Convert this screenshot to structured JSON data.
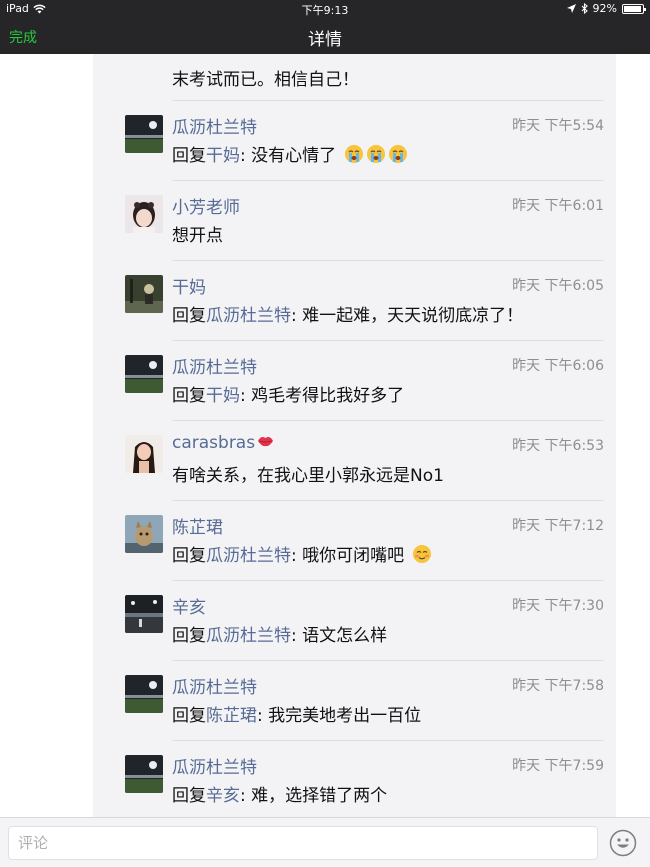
{
  "status_bar": {
    "device": "iPad",
    "time": "下午9:13",
    "battery": "92%",
    "battery_level": 0.92,
    "icons": [
      "wifi-icon",
      "location-icon",
      "bluetooth-icon",
      "battery-icon"
    ]
  },
  "nav": {
    "done_label": "完成",
    "title": "详情"
  },
  "partial_comment": {
    "text": "末考试而已。相信自己！"
  },
  "comments": [
    {
      "author": "瓜沥杜兰特",
      "time": "昨天 下午5:54",
      "reply_prefix": "回复",
      "reply_to": "干妈",
      "separator": ": ",
      "text": "没有心情了",
      "emoji": "crying-face-icon x3"
    },
    {
      "author": "小芳老师",
      "time": "昨天 下午6:01",
      "text": "想开点"
    },
    {
      "author": "干妈",
      "time": "昨天 下午6:05",
      "reply_prefix": "回复",
      "reply_to": "瓜沥杜兰特",
      "separator": ": ",
      "text": "难一起难，天天说彻底凉了！"
    },
    {
      "author": "瓜沥杜兰特",
      "time": "昨天 下午6:06",
      "reply_prefix": "回复",
      "reply_to": "干妈",
      "separator": ": ",
      "text": "鸡毛考得比我好多了"
    },
    {
      "author": "carasbras",
      "time": "昨天 下午6:53",
      "text": "有啥关系，在我心里小郭永远是No1",
      "emoji": "lips-icon"
    },
    {
      "author": "陈芷珺",
      "time": "昨天 下午7:12",
      "reply_prefix": "回复",
      "reply_to": "瓜沥杜兰特",
      "separator": ": ",
      "text": "哦你可闭嘴吧",
      "emoji": "blushing-face-icon"
    },
    {
      "author": "辛亥",
      "time": "昨天 下午7:30",
      "reply_prefix": "回复",
      "reply_to": "瓜沥杜兰特",
      "separator": ": ",
      "text": "语文怎么样"
    },
    {
      "author": "瓜沥杜兰特",
      "time": "昨天 下午7:58",
      "reply_prefix": "回复",
      "reply_to": "陈芷珺",
      "separator": ": ",
      "text": "我完美地考出一百位"
    },
    {
      "author": "瓜沥杜兰特",
      "time": "昨天 下午7:59",
      "reply_prefix": "回复",
      "reply_to": "辛亥",
      "separator": ": ",
      "text": "难，选择错了两个"
    }
  ],
  "input": {
    "placeholder": "评论",
    "value": ""
  },
  "colors": {
    "bar_background": "#262629",
    "done_green": "#26c83c",
    "link_blue": "#576b95",
    "panel_background": "#f3f3f5",
    "time_gray": "#8e8e93"
  }
}
